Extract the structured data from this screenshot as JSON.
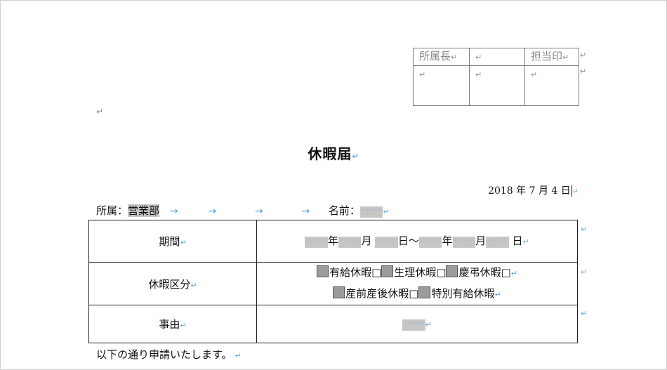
{
  "paragraph_mark": "↵",
  "stamp": {
    "header": [
      "所属長",
      "",
      "担当印"
    ]
  },
  "title": "休暇届",
  "date": "2018 年 7 月 4 日",
  "affiliation": {
    "label": "所属：",
    "department": "営業部",
    "name_label": "名前：",
    "arrows": [
      "→",
      "→",
      "→",
      "→"
    ]
  },
  "placeholder": "◦◦◦◦◦",
  "table": {
    "period_label": "期間",
    "year": "年",
    "month": "月",
    "day": "日",
    "range": "〜",
    "leave_type_label": "休暇区分",
    "leave_types_line1": [
      "有給休暇□",
      "生理休暇□",
      "慶弔休暇□"
    ],
    "leave_types_line2": [
      "産前産後休暇□",
      "特別有給休暇"
    ],
    "reason_label": "事由"
  },
  "footer": "以下の通り申請いたします。"
}
